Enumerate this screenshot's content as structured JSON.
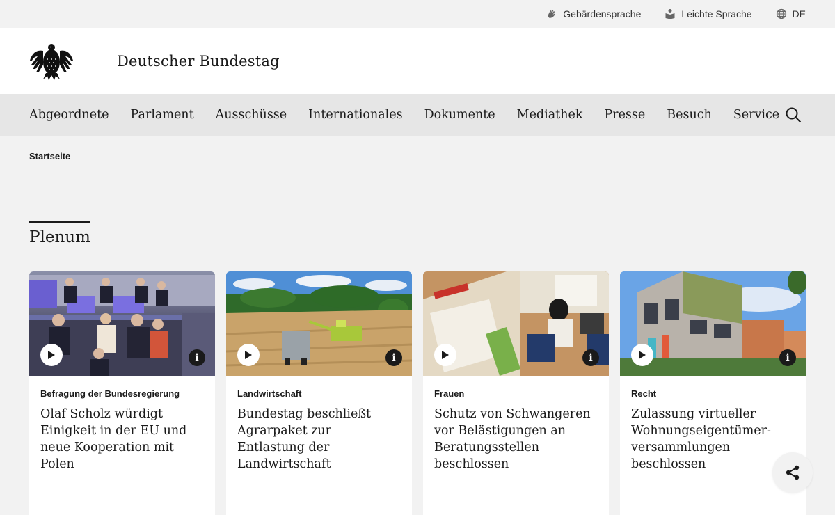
{
  "topbar": {
    "sign_language": "Gebärdensprache",
    "easy_language": "Leichte Sprache",
    "language": "DE"
  },
  "header": {
    "title": "Deutscher Bundestag",
    "logo_icon": "federal-eagle-icon"
  },
  "nav": {
    "items": [
      "Abgeordnete",
      "Parlament",
      "Ausschüsse",
      "Internationales",
      "Dokumente",
      "Mediathek",
      "Presse",
      "Besuch",
      "Service"
    ],
    "search_icon": "search-icon"
  },
  "breadcrumb": "Startseite",
  "section": {
    "title": "Plenum"
  },
  "cards": [
    {
      "category": "Befragung der Bundesregierung",
      "headline": "Olaf Scholz würdigt Einigkeit in der EU und neue Kooperation mit Polen"
    },
    {
      "category": "Landwirtschaft",
      "headline": "Bundestag beschließt Agrarpaket zur Entlastung der Landwirtschaft"
    },
    {
      "category": "Frauen",
      "headline": "Schutz von Schwangeren vor Belästigungen an Bera­tungsstellen beschlossen"
    },
    {
      "category": "Recht",
      "headline": "Zulassung virtueller Wohnungseigentümer­versammlungen beschlossen"
    }
  ],
  "colors": {
    "background": "#f2f2f2",
    "nav_background": "#e6e6e6",
    "header_background": "#ffffff",
    "text": "#1a1a1a"
  }
}
